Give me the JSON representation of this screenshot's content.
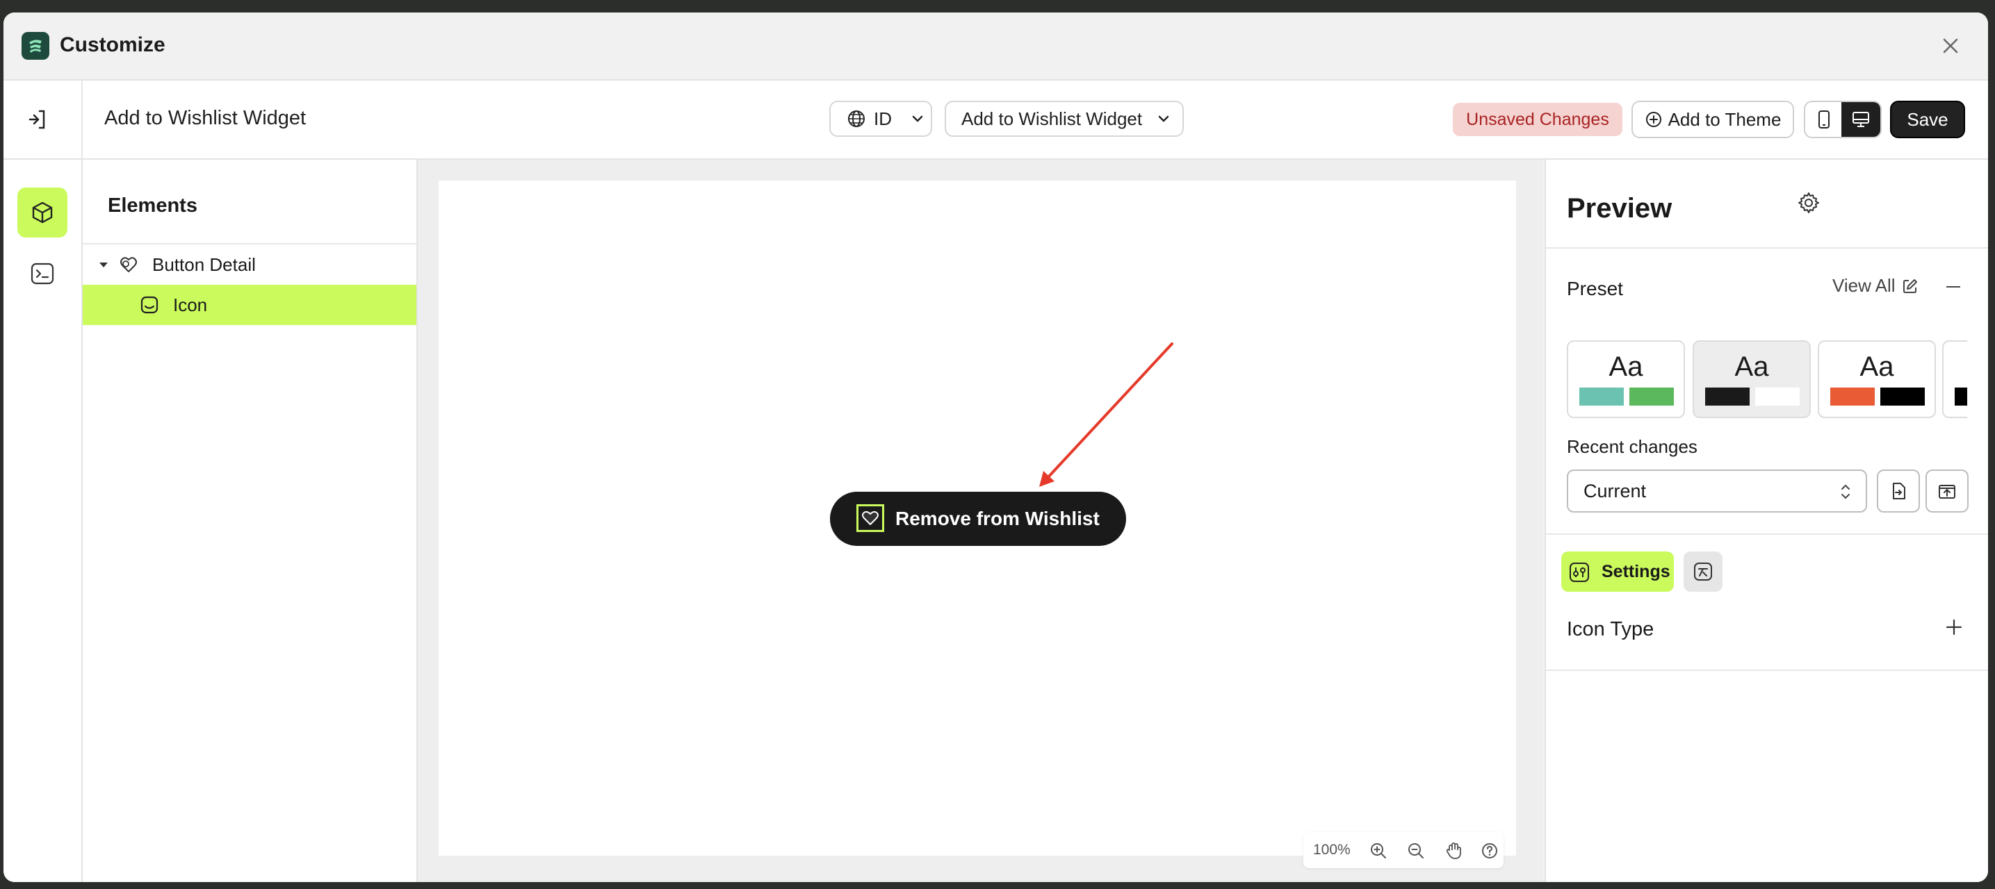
{
  "window": {
    "title": "Customize",
    "close_icon": "close-icon",
    "logo_icon": "app-logo-icon"
  },
  "topbar": {
    "exit_icon": "exit-icon",
    "page_name": "Add to Wishlist Widget",
    "language": {
      "icon": "globe-icon",
      "value": "ID"
    },
    "widget_select": {
      "value": "Add to Wishlist Widget"
    },
    "unsaved_badge": "Unsaved Changes",
    "add_to_theme": "Add to Theme",
    "save": "Save",
    "device_mode": "desktop"
  },
  "rail": {
    "items": [
      {
        "name": "elements",
        "icon": "cube-icon",
        "active": true
      },
      {
        "name": "code",
        "icon": "terminal-icon",
        "active": false
      }
    ]
  },
  "elements_panel": {
    "title": "Elements",
    "tree": [
      {
        "label": "Button Detail",
        "icon": "wishlist-group-icon",
        "expanded": true,
        "selected": false
      },
      {
        "label": "Icon",
        "icon": "icon-element-icon",
        "selected": true
      }
    ]
  },
  "canvas": {
    "button_label": "Remove from Wishlist",
    "zoom_level": "100%",
    "accent": "#cbfa5c"
  },
  "preview_panel": {
    "title": "Preview",
    "preset_label": "Preset",
    "view_all": "View All",
    "presets": [
      {
        "label": "Aa",
        "colors": [
          "#6cc2b0",
          "#5cb85c"
        ],
        "selected": false
      },
      {
        "label": "Aa",
        "colors": [
          "#1a1a1a",
          "#ffffff"
        ],
        "selected": true
      },
      {
        "label": "Aa",
        "colors": [
          "#e85b35",
          "#000000"
        ],
        "selected": false
      },
      {
        "label": "Aa",
        "colors": [
          "#000000"
        ],
        "selected": false
      }
    ],
    "recent_changes_label": "Recent changes",
    "recent_changes_value": "Current",
    "tabs": {
      "settings": "Settings"
    },
    "section": "Icon Type"
  }
}
